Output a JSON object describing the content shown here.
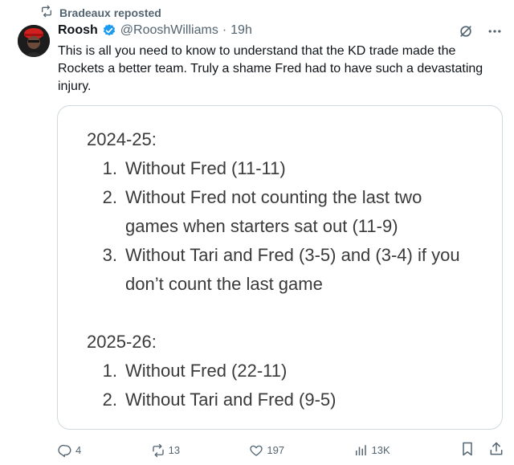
{
  "repost": {
    "text": "Bradeaux reposted",
    "icon": "repost-icon"
  },
  "author": {
    "name": "Roosh",
    "handle": "@RooshWilliams",
    "separator": "·",
    "time": "19h",
    "verified": true
  },
  "tweet": {
    "text": "This is all you need to know to understand that the KD trade made the Rockets a better team. Truly a shame Fred had to have such a devastating injury."
  },
  "card": {
    "sections": [
      {
        "title": "2024-25:",
        "items": [
          {
            "num": "1.",
            "text": "Without Fred (11-11)"
          },
          {
            "num": "2.",
            "text": "Without Fred not counting the last two games when starters sat out (11-9)"
          },
          {
            "num": "3.",
            "text": "Without Tari and Fred (3-5) and (3-4) if you don’t count the last game"
          }
        ]
      },
      {
        "title": "2025-26:",
        "items": [
          {
            "num": "1.",
            "text": "Without Fred (22-11)"
          },
          {
            "num": "2.",
            "text": "Without Tari and Fred (9-5)"
          }
        ]
      }
    ]
  },
  "actions": {
    "replies": "4",
    "reposts": "13",
    "likes": "197",
    "views": "13K"
  },
  "colors": {
    "text": "#0f1419",
    "secondary": "#536471",
    "verified": "#1d9bf0",
    "border": "#cfd9de"
  }
}
